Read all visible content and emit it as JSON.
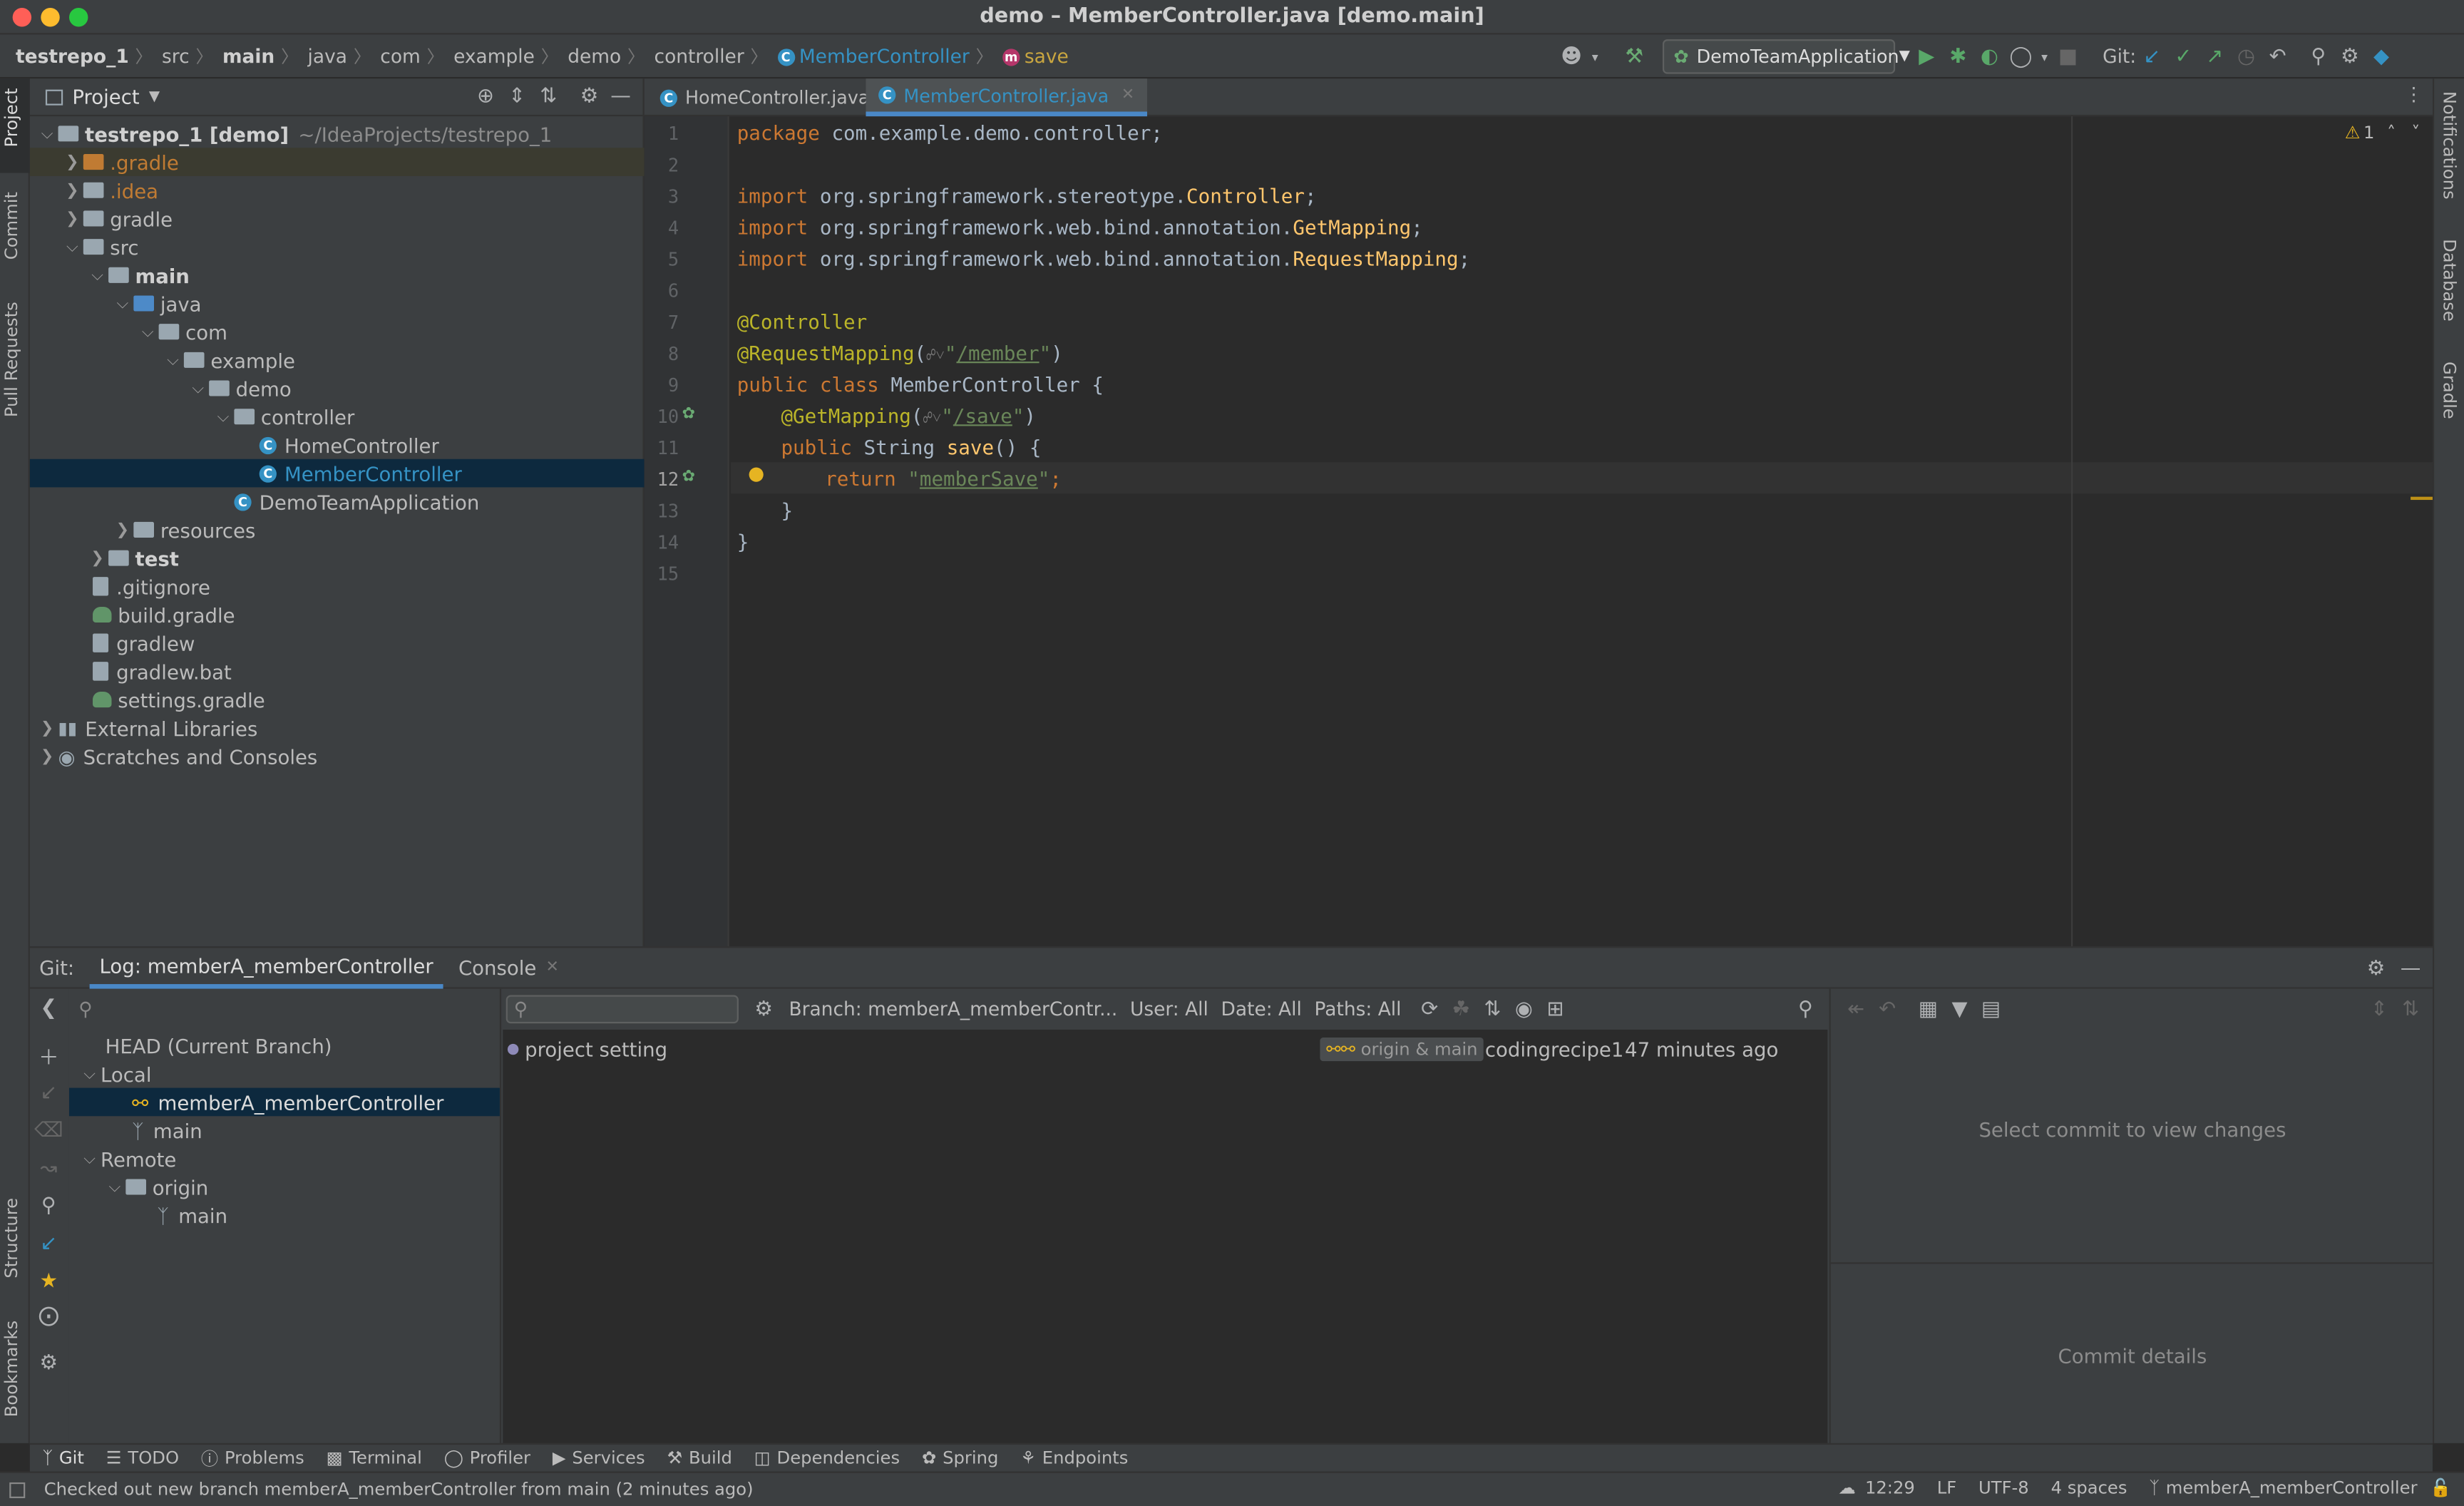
{
  "window": {
    "title": "demo – MemberController.java [demo.main]"
  },
  "colors": {
    "close": "#ff5f57",
    "minimize": "#febc2e",
    "zoom": "#28c840",
    "accent": "#3592c4",
    "selection": "#0d293e"
  },
  "breadcrumb": [
    "testrepo_1",
    "src",
    "main",
    "java",
    "com",
    "example",
    "demo",
    "controller",
    "MemberController",
    "save"
  ],
  "toolbar": {
    "run_config": "DemoTeamApplication",
    "git_label": "Git:"
  },
  "project_panel": {
    "title": "Project",
    "root_name": "testrepo_1 [demo]",
    "root_path": "~/IdeaProjects/testrepo_1",
    "tree": [
      ".gradle",
      ".idea",
      "gradle",
      "src",
      "main",
      "java",
      "com",
      "example",
      "demo",
      "controller",
      "HomeController",
      "MemberController",
      "DemoTeamApplication",
      "resources",
      "test",
      ".gitignore",
      "build.gradle",
      "gradlew",
      "gradlew.bat",
      "settings.gradle",
      "External Libraries",
      "Scratches and Consoles"
    ]
  },
  "left_strip": {
    "project": "Project",
    "commit": "Commit",
    "pull_requests": "Pull Requests",
    "structure": "Structure",
    "bookmarks": "Bookmarks"
  },
  "right_strip": {
    "notifications": "Notifications",
    "database": "Database",
    "gradle": "Gradle"
  },
  "editor": {
    "tabs": [
      {
        "label": "HomeController.java",
        "active": false
      },
      {
        "label": "MemberController.java",
        "active": true
      }
    ],
    "warning_count": "1",
    "line_numbers": [
      "1",
      "2",
      "3",
      "4",
      "5",
      "6",
      "7",
      "8",
      "9",
      "10",
      "11",
      "12",
      "13",
      "14",
      "15"
    ],
    "code": {
      "l1_kw": "package",
      "l1_rest": " com.example.demo.controller;",
      "l3_kw": "import",
      "l3_pkg": " org.springframework.stereotype.",
      "l3_cls": "Controller",
      "l3_end": ";",
      "l4_kw": "import",
      "l4_pkg": " org.springframework.web.bind.annotation.",
      "l4_cls": "GetMapping",
      "l4_end": ";",
      "l5_kw": "import",
      "l5_pkg": " org.springframework.web.bind.annotation.",
      "l5_cls": "RequestMapping",
      "l5_end": ";",
      "l7_ann": "@Controller",
      "l8_ann": "@RequestMapping",
      "l8_open": "(",
      "l8_q1": "\"",
      "l8_path": "/member",
      "l8_q2": "\"",
      "l8_close": ")",
      "l9_kw": "public class",
      "l9_name": " MemberController {",
      "l10_ann": "@GetMapping",
      "l10_open": "(",
      "l10_q1": "\"",
      "l10_path": "/save",
      "l10_q2": "\"",
      "l10_close": ")",
      "l11_kw": "public",
      "l11_type": " String ",
      "l11_fn": "save",
      "l11_end": "() {",
      "l12_kw": "return",
      "l12_q1": "\"",
      "l12_str": "memberSave",
      "l12_q2": "\"",
      "l12_end": ";",
      "l13": "}",
      "l14": "}"
    }
  },
  "bottom": {
    "git_label": "Git:",
    "tab_log": "Log: memberA_memberController",
    "tab_console": "Console",
    "branches": {
      "head": "HEAD (Current Branch)",
      "local": "Local",
      "local_items": [
        "memberA_memberController",
        "main"
      ],
      "remote": "Remote",
      "origin": "origin",
      "origin_items": [
        "main"
      ]
    },
    "filters": {
      "branch": "Branch: memberA_memberContr...",
      "user": "User: All",
      "date": "Date: All",
      "paths": "Paths: All"
    },
    "commits": [
      {
        "message": "project setting",
        "refs": "origin & main",
        "author": "codingrecipe1",
        "time": "47 minutes ago"
      }
    ],
    "details": {
      "changes_hint": "Select commit to view changes",
      "details_hint": "Commit details"
    }
  },
  "tool_windows": [
    "Git",
    "TODO",
    "Problems",
    "Terminal",
    "Profiler",
    "Services",
    "Build",
    "Dependencies",
    "Spring",
    "Endpoints"
  ],
  "status": {
    "message": "Checked out new branch memberA_memberController from main (2 minutes ago)",
    "time": "12:29",
    "line_sep": "LF",
    "encoding": "UTF-8",
    "indent": "4 spaces",
    "branch": "memberA_memberController"
  }
}
